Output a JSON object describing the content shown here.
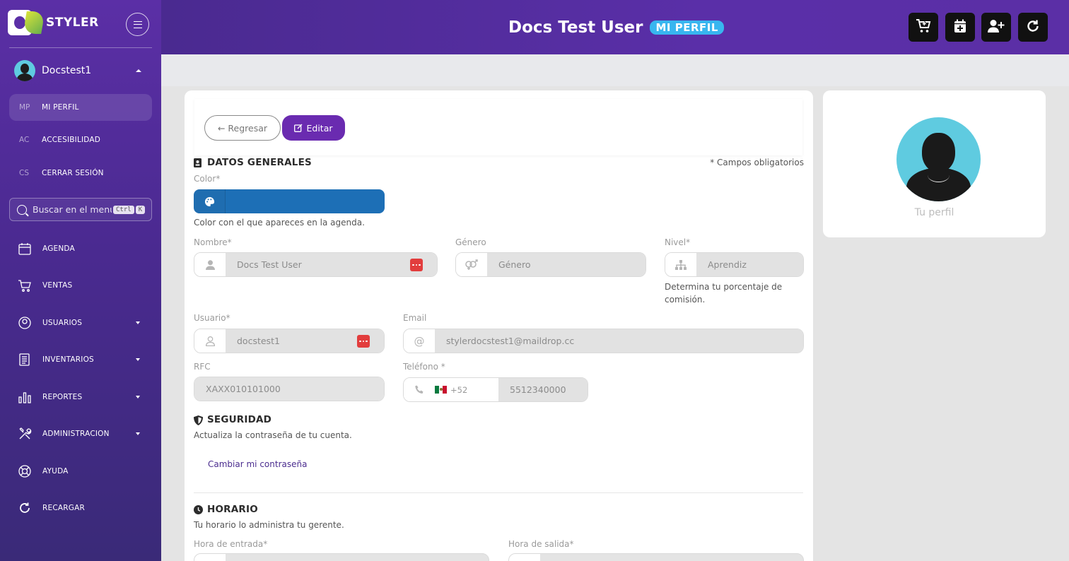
{
  "brand": {
    "name": "STYLER"
  },
  "sidebar": {
    "user_name": "Docstest1",
    "sub_items": [
      {
        "abbr": "MP",
        "label": "MI PERFIL",
        "active": true
      },
      {
        "abbr": "AC",
        "label": "ACCESIBILIDAD",
        "active": false
      },
      {
        "abbr": "CS",
        "label": "CERRAR SESIÓN",
        "active": false
      }
    ],
    "search": {
      "placeholder": "Buscar en el menú",
      "shortcut_ctrl": "Ctrl",
      "shortcut_key": "K"
    },
    "nav": [
      {
        "label": "AGENDA",
        "icon": "calendar-icon",
        "has_caret": false
      },
      {
        "label": "VENTAS",
        "icon": "cart-icon",
        "has_caret": false
      },
      {
        "label": "USUARIOS",
        "icon": "user-circle-icon",
        "has_caret": true
      },
      {
        "label": "INVENTARIOS",
        "icon": "clipboard-icon",
        "has_caret": true
      },
      {
        "label": "REPORTES",
        "icon": "bar-chart-icon",
        "has_caret": true
      },
      {
        "label": "ADMINISTRACION",
        "icon": "tools-icon",
        "has_caret": true
      },
      {
        "label": "AYUDA",
        "icon": "lifebuoy-icon",
        "has_caret": false
      },
      {
        "label": "RECARGAR",
        "icon": "reload-icon",
        "has_caret": false
      }
    ]
  },
  "header": {
    "title": "Docs Test User",
    "badge": "MI PERFIL",
    "actions": [
      "cart-plus-icon",
      "calendar-plus-icon",
      "user-plus-icon",
      "refresh-icon"
    ]
  },
  "form": {
    "back_label": "Regresar",
    "edit_label": "Editar",
    "general_title": "DATOS GENERALES",
    "required_note": "* Campos obligatorios",
    "color": {
      "label": "Color*",
      "value": "#1d6fb6",
      "help": "Color con el que apareces en la agenda."
    },
    "nombre": {
      "label": "Nombre*",
      "value": "Docs Test User"
    },
    "genero": {
      "label": "Género",
      "placeholder": "Género"
    },
    "nivel": {
      "label": "Nivel*",
      "placeholder": "Aprendiz",
      "help": "Determina tu porcentaje de comisión."
    },
    "usuario": {
      "label": "Usuario*",
      "value": "docstest1"
    },
    "email": {
      "label": "Email",
      "value": "stylerdocstest1@maildrop.cc"
    },
    "rfc": {
      "label": "RFC",
      "placeholder": "XAXX010101000"
    },
    "telefono": {
      "label": "Teléfono *",
      "code": "+52",
      "value": "5512340000"
    },
    "security_title": "SEGURIDAD",
    "security_desc": "Actualiza la contraseña de tu cuenta.",
    "change_password": "Cambiar mi contraseña",
    "schedule_title": "HORARIO",
    "schedule_desc": "Tu horario lo administra tu gerente.",
    "entrada_label": "Hora de entrada*",
    "salida_label": "Hora de salida*"
  },
  "profile_card": {
    "label": "Tu perfil"
  },
  "colors": {
    "accent": "#6a2bb0",
    "sidebar": "#4a2a90",
    "badge": "#38b6ef",
    "danger": "#e23d3d"
  }
}
